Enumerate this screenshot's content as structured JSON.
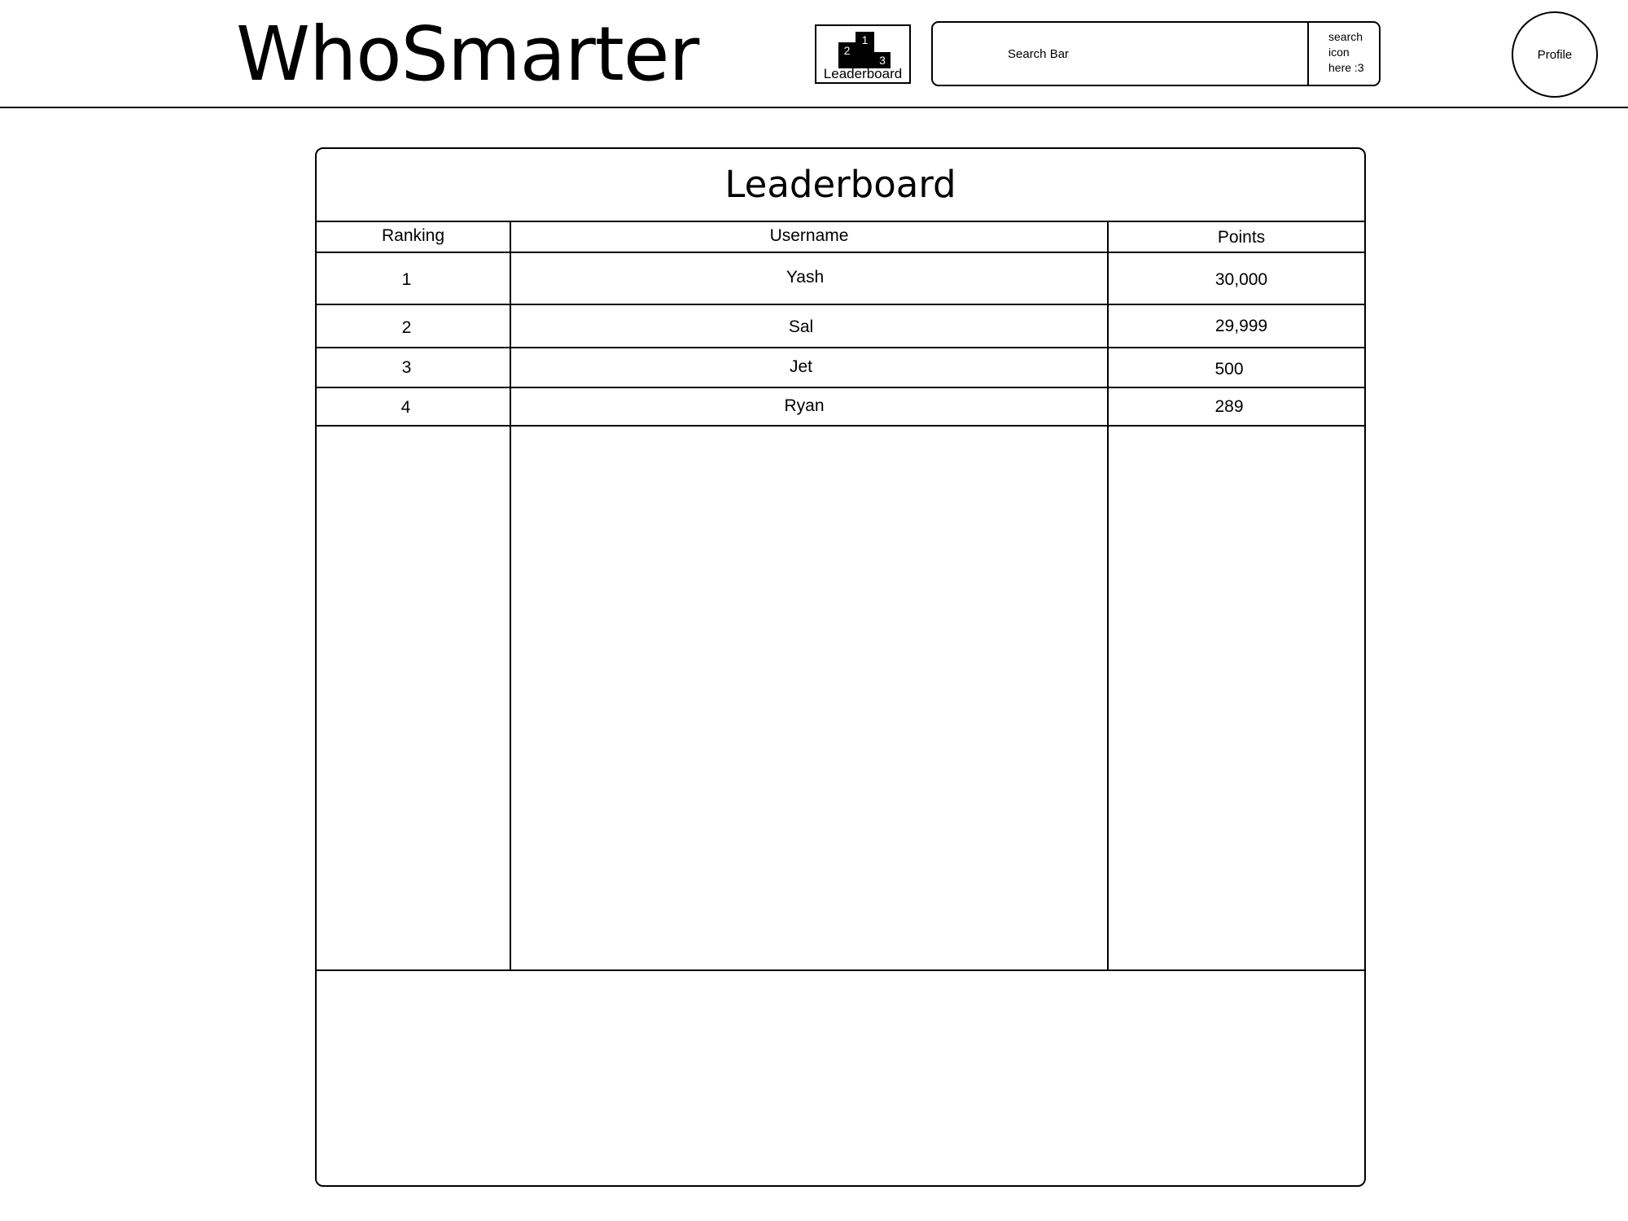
{
  "header": {
    "app_title": "WhoSmarter",
    "leaderboard_nav": {
      "label": "Leaderboard",
      "podium": [
        "1",
        "2",
        "3"
      ]
    },
    "search": {
      "placeholder": "Search Bar",
      "icon_label": "search\nicon\nhere :3"
    },
    "profile_label": "Profile"
  },
  "leaderboard": {
    "title": "Leaderboard",
    "columns": [
      "Ranking",
      "Username",
      "Points"
    ],
    "rows": [
      {
        "rank": "1",
        "username": "Yash",
        "points": "30,000"
      },
      {
        "rank": "2",
        "username": "Sal",
        "points": "29,999"
      },
      {
        "rank": "3",
        "username": "Jet",
        "points": "500"
      },
      {
        "rank": "4",
        "username": "Ryan",
        "points": "289"
      }
    ]
  }
}
